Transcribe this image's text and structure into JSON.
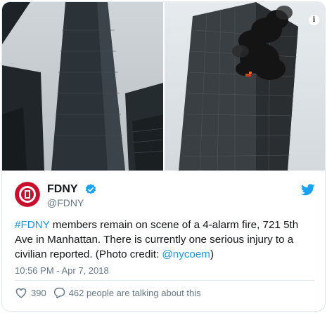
{
  "tweet": {
    "display_name": "FDNY",
    "handle": "@FDNY",
    "text_parts": {
      "hashtag": "#FDNY",
      "body": " members remain on scene of a 4-alarm fire, 721 5th Ave in Manhattan. There is currently one serious injury to a civilian reported. (Photo credit: ",
      "mention": "@nycoem",
      "tail": ")"
    },
    "timestamp": "10:56 PM - Apr 7, 2018",
    "like_count": "390",
    "talking_label": "462 people are talking about this"
  },
  "icons": {
    "info": "info-icon",
    "verified": "verified-badge-icon",
    "bird": "twitter-bird-icon",
    "heart": "heart-icon",
    "reply": "speech-bubble-icon"
  },
  "colors": {
    "link": "#1b95e0",
    "muted": "#657786",
    "verified": "#1da1f2",
    "fdny_red": "#c8102e"
  }
}
